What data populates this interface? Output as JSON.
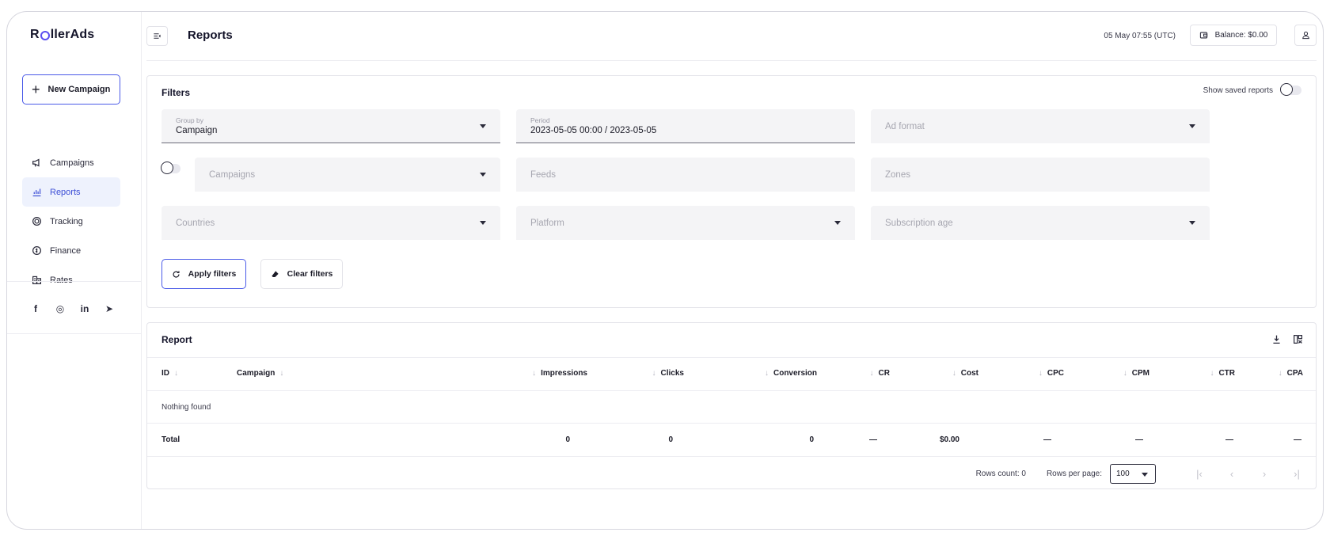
{
  "app": {
    "logo_prefix": "R",
    "logo_suffix": "llerAds",
    "accent_color": "#4a5ae8"
  },
  "sidebar": {
    "new_campaign_label": "New Campaign",
    "items": [
      {
        "label": "Campaigns",
        "icon": "megaphone-icon",
        "active": false
      },
      {
        "label": "Reports",
        "icon": "chart-icon",
        "active": true
      },
      {
        "label": "Tracking",
        "icon": "target-icon",
        "active": false
      },
      {
        "label": "Finance",
        "icon": "coin-icon",
        "active": false
      },
      {
        "label": "Rates",
        "icon": "buildings-icon",
        "active": false
      }
    ],
    "socials": [
      "f",
      "◎",
      "in",
      "➤"
    ]
  },
  "header": {
    "title": "Reports",
    "datetime": "05 May 07:55 (UTC)",
    "balance": "Balance: $0.00"
  },
  "filters": {
    "title": "Filters",
    "show_saved_reports": "Show saved reports",
    "group_by": {
      "label": "Group by",
      "value": "Campaign"
    },
    "period": {
      "label": "Period",
      "value": "2023-05-05 00:00 / 2023-05-05"
    },
    "ad_format": "Ad format",
    "campaigns": "Campaigns",
    "feeds": "Feeds",
    "zones": "Zones",
    "countries": "Countries",
    "platform": "Platform",
    "subscription_age": "Subscription age",
    "apply_label": "Apply filters",
    "clear_label": "Clear filters"
  },
  "report": {
    "title": "Report",
    "columns": [
      "ID",
      "Campaign",
      "Impressions",
      "Clicks",
      "Conversion",
      "CR",
      "Cost",
      "CPC",
      "CPM",
      "CTR",
      "CPA"
    ],
    "empty_text": "Nothing found",
    "total": {
      "label": "Total",
      "impressions": "0",
      "clicks": "0",
      "conversion": "0",
      "cr": "—",
      "cost": "$0.00",
      "cpc": "—",
      "cpm": "—",
      "ctr": "—",
      "cpa": "—"
    },
    "rows_count": "Rows count: 0",
    "rows_per_page_label": "Rows per page:",
    "rows_per_page": "100"
  }
}
